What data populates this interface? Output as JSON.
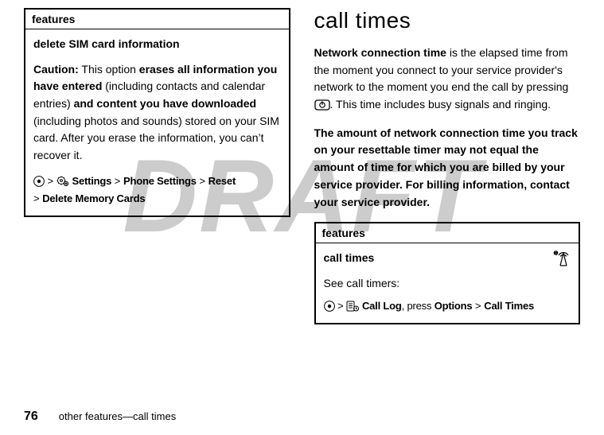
{
  "watermark": "DRAFT",
  "left": {
    "features_header": "features",
    "subtitle": "delete SIM card information",
    "caution_label": "Caution:",
    "caution_t1": " This option ",
    "caution_b1": "erases all information you have entered",
    "caution_t2": " (including contacts and calendar entries) ",
    "caution_b2": "and content you have downloaded",
    "caution_t3": " (including photos and sounds) stored on your SIM card. After you erase the information, you can’t recover it.",
    "nav": {
      "settings": "Settings",
      "phone_settings": "Phone Settings",
      "reset": "Reset",
      "delete_memory": "Delete Memory Cards",
      "gt": ">"
    }
  },
  "right": {
    "title": "call times",
    "p1_b": "Network connection time",
    "p1_t": " is the elapsed time from the moment you connect to your service provider's network to the moment you end the call by pressing ",
    "p1_t2": ". This time includes busy signals and ringing.",
    "p2": "The amount of network connection time you track on your resettable timer may not equal the amount of time for which you are billed by your service provider. For billing information, contact your service provider.",
    "box": {
      "features_header": "features",
      "subtitle": "call times",
      "see": "See call timers:",
      "nav": {
        "call_log": "Call Log",
        "press": ", press ",
        "options": "Options",
        "gt": ">",
        "call_times": "Call Times"
      }
    }
  },
  "footer": {
    "page": "76",
    "text": "other features—call times"
  }
}
